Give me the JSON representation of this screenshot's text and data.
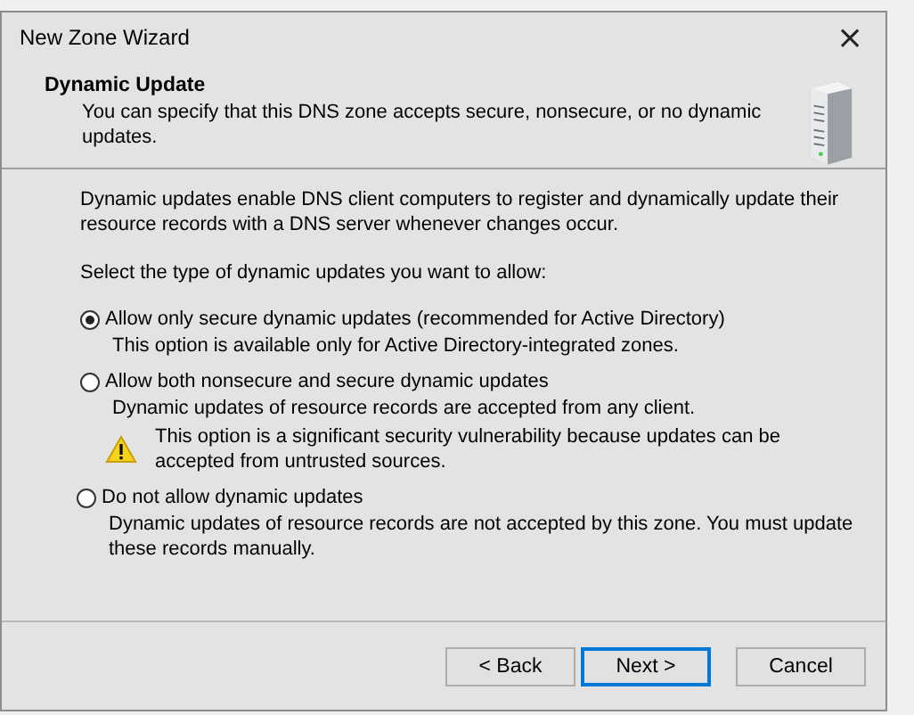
{
  "window": {
    "title": "New Zone Wizard",
    "close": "×"
  },
  "header": {
    "title": "Dynamic Update",
    "subtitle": "You can specify that this DNS zone accepts secure, nonsecure, or no dynamic updates."
  },
  "intro": "Dynamic updates enable DNS client computers to register and dynamically update their resource records with a DNS server whenever changes occur.",
  "prompt": "Select the type of dynamic updates you want to allow:",
  "options": [
    {
      "label": "Allow only secure dynamic updates (recommended for Active Directory)",
      "description": "This option is available only for Active Directory-integrated zones.",
      "selected": true
    },
    {
      "label": "Allow both nonsecure and secure dynamic updates",
      "description": "Dynamic updates of resource records are accepted from any client.",
      "warning": "This option is a significant security vulnerability because updates can be accepted from untrusted sources.",
      "selected": false
    },
    {
      "label": "Do not allow dynamic updates",
      "description": "Dynamic updates of resource records are not accepted by this zone. You must update these records manually.",
      "selected": false
    }
  ],
  "buttons": [
    {
      "label": "< Back",
      "default": false
    },
    {
      "label": "Next >",
      "default": true
    },
    {
      "label": "Cancel",
      "default": false
    }
  ]
}
